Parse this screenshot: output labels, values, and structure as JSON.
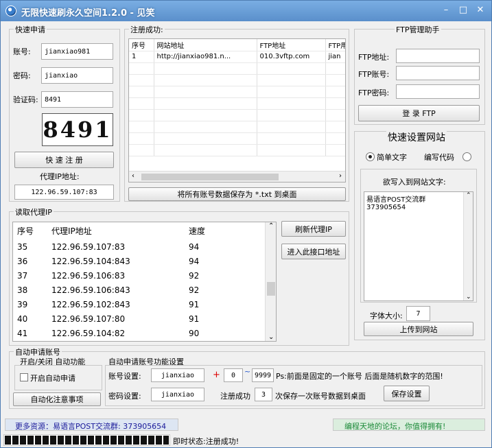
{
  "window": {
    "title": "无限快速刷永久空间1.2.0 - 见笑",
    "minimize": "–",
    "maximize": "□",
    "close": "✕"
  },
  "quick_apply": {
    "caption": "快速申请",
    "account_label": "账号:",
    "account_value": "jianxiao981",
    "password_label": "密码:",
    "password_value": "jianxiao",
    "captcha_label": "验证码:",
    "captcha_value": "8491",
    "captcha_image_text": "8491",
    "register_button": "快 速 注 册",
    "proxy_label": "代理IP地址:",
    "proxy_value": "122.96.59.107:83"
  },
  "registered": {
    "caption": "注册成功:",
    "columns": [
      "序号",
      "网站地址",
      "FTP地址",
      "FTP用"
    ],
    "rows": [
      [
        "1",
        "http://jianxiao981.n...",
        "010.3vftp.com",
        "jian"
      ]
    ],
    "save_button": "将所有账号数据保存为 *.txt 到桌面"
  },
  "ftp": {
    "caption": "FTP管理助手",
    "address_label": "FTP地址:",
    "account_label": "FTP账号:",
    "password_label": "FTP密码:",
    "login_button": "登 录 FTP"
  },
  "site": {
    "caption": "快速设置网站",
    "radio_simple": "简单文字",
    "radio_code": "编写代码",
    "write_label": "欲写入到网站文字:",
    "text_line1": "易语言POST交流群",
    "text_line2": "373905654",
    "font_size_label": "字体大小:",
    "font_size_value": "7",
    "upload_button": "上传到网站"
  },
  "proxy": {
    "caption": "读取代理IP",
    "columns": [
      "序号",
      "代理IP地址",
      "速度"
    ],
    "rows": [
      [
        "35",
        "122.96.59.107:83",
        "94"
      ],
      [
        "36",
        "122.96.59.104:843",
        "94"
      ],
      [
        "37",
        "122.96.59.106:83",
        "92"
      ],
      [
        "38",
        "122.96.59.106:843",
        "92"
      ],
      [
        "39",
        "122.96.59.102:843",
        "91"
      ],
      [
        "40",
        "122.96.59.107:80",
        "91"
      ],
      [
        "41",
        "122.96.59.104:82",
        "90"
      ]
    ],
    "refresh_button": "刷新代理IP",
    "enter_button": "进入此接口地址"
  },
  "auto": {
    "caption": "自动申请账号",
    "onoff_label": "开启/关闭 自动功能",
    "checkbox_label": "开启自动申请",
    "notice_button": "自动化注意事项",
    "settings_caption": "自动申请账号功能设置",
    "account_label": "账号设置:",
    "account_value": "jianxiao",
    "plus": "+",
    "start_value": "0",
    "tilde": "~",
    "end_value": "9999",
    "ps_text": "Ps:前面是固定的一个账号 后面是随机数字的范围!",
    "password_label": "密码设置:",
    "password_value": "jianxiao",
    "success_label": "注册成功",
    "success_count": "3",
    "save_text": "次保存一次账号数据到桌面",
    "save_button": "保存设置"
  },
  "footer": {
    "more": "更多资源：易语言POST交流群: 373905654",
    "slogan": "编程天地的论坛，你值得拥有!",
    "status_label": "即时状态:注册成功!",
    "progress": 1.0
  },
  "colors": {
    "title_bar": "#5a8fcb",
    "more_text": "#1a1a9a",
    "slogan_text": "#1d8b3a"
  }
}
